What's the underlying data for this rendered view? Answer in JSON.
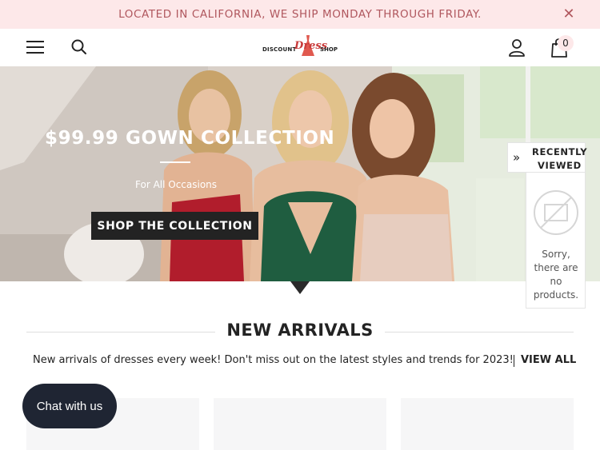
{
  "announcement": {
    "text": "LOCATED IN CALIFORNIA, WE SHIP MONDAY THROUGH FRIDAY.",
    "close_icon": "close-icon"
  },
  "header": {
    "menu_icon": "hamburger-menu-icon",
    "search_icon": "search-icon",
    "logo": {
      "word1": "DISCOUNT",
      "word2": "Dress",
      "word3": "SHOP"
    },
    "account_icon": "user-icon",
    "cart_icon": "shopping-bag-icon",
    "cart_count": "0"
  },
  "hero": {
    "title": "$99.99 GOWN COLLECTION",
    "subtitle": "For All Occasions",
    "cta_label": "SHOP THE COLLECTION"
  },
  "recently_viewed": {
    "label_line1": "RECENTLY",
    "label_line2": "VIEWED",
    "empty_message": "Sorry, there are no products."
  },
  "new_arrivals": {
    "title": "NEW ARRIVALS",
    "description": "New arrivals of dresses every week! Don't miss out on the latest styles and trends for 2023!",
    "view_all_label": "VIEW ALL"
  },
  "chat": {
    "label": "Chat with us"
  },
  "colors": {
    "announcement_bg": "#fde8e9",
    "announcement_text": "#b0575e",
    "dark": "#232323",
    "chat_bg": "#1f2533",
    "logo_red": "#c93a3a"
  }
}
